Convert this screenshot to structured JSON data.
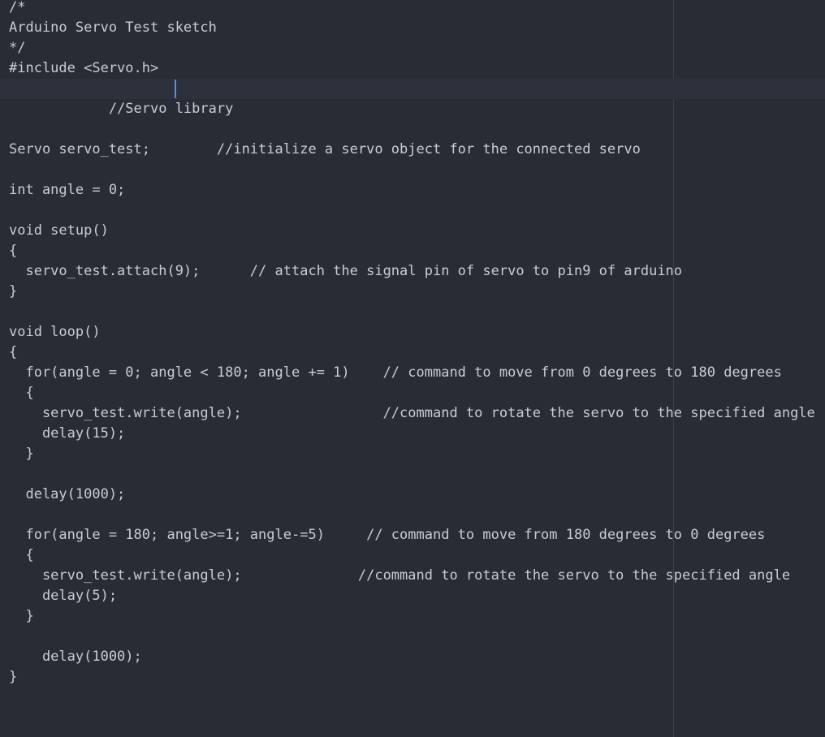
{
  "editor": {
    "language": "arduino",
    "lines": [
      "/*",
      "Arduino Servo Test sketch",
      "*/",
      "#include <Servo.h>",
      "",
      "            //Servo library",
      "",
      "Servo servo_test;        //initialize a servo object for the connected servo",
      "",
      "int angle = 0;",
      "",
      "void setup()",
      "{",
      "  servo_test.attach(9);      // attach the signal pin of servo to pin9 of arduino",
      "}",
      "",
      "void loop()",
      "{",
      "  for(angle = 0; angle < 180; angle += 1)    // command to move from 0 degrees to 180 degrees",
      "  {",
      "    servo_test.write(angle);                 //command to rotate the servo to the specified angle",
      "    delay(15);",
      "  }",
      "",
      "  delay(1000);",
      "",
      "  for(angle = 180; angle>=1; angle-=5)     // command to move from 180 degrees to 0 degrees",
      "  {",
      "    servo_test.write(angle);              //command to rotate the servo to the specified angle",
      "    delay(5);",
      "  }",
      "",
      "    delay(1000);",
      "}"
    ],
    "cursor_line_index": 4,
    "colors": {
      "background": "#282c34",
      "text": "#c8ccd4",
      "cursor_line": "#2c313c",
      "cursor": "#528bff",
      "wrap_guide": "#3a3f4b"
    }
  }
}
